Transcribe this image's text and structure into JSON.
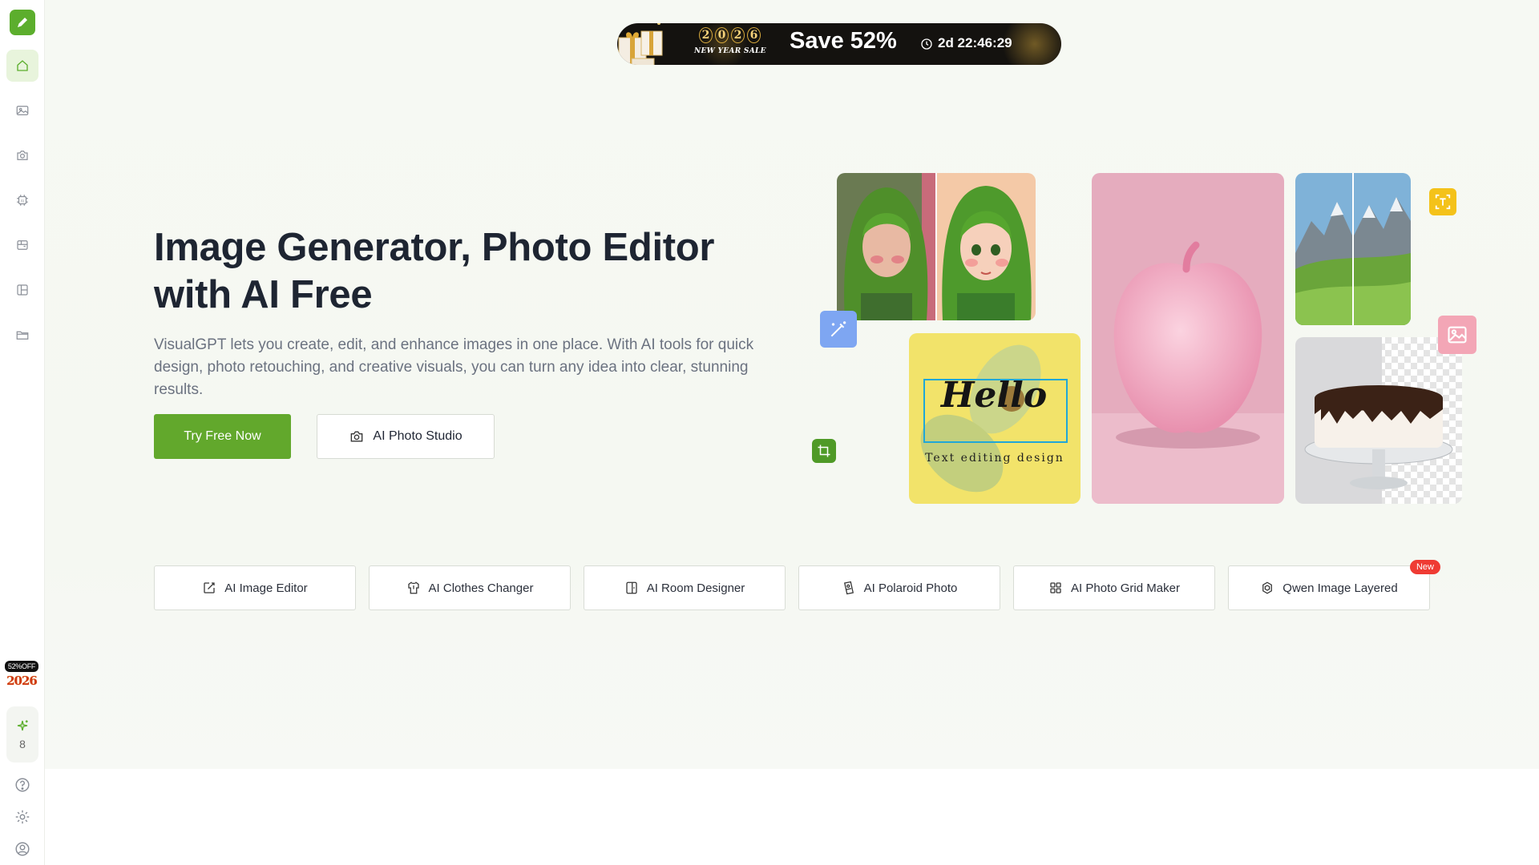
{
  "promo": {
    "year_digits": [
      "2",
      "0",
      "2",
      "6"
    ],
    "subtitle": "NEW YEAR SALE",
    "save_text": "Save 52%",
    "timer": "2d 22:46:29"
  },
  "hero": {
    "title": "Image Generator, Photo Editor with AI Free",
    "description": "VisualGPT lets you create, edit, and enhance images in one place. With AI tools for quick design, photo retouching, and creative visuals, you can turn any idea into clear, stunning results.",
    "primary_button": "Try Free Now",
    "secondary_button": "AI Photo Studio"
  },
  "collage": {
    "hello_text": "Hello",
    "hello_caption": "Text editing design"
  },
  "tools": [
    {
      "label": "AI Image Editor",
      "icon": "edit-image-icon"
    },
    {
      "label": "AI Clothes Changer",
      "icon": "shirt-icon"
    },
    {
      "label": "AI Room Designer",
      "icon": "room-icon"
    },
    {
      "label": "AI Polaroid Photo",
      "icon": "polaroid-icon"
    },
    {
      "label": "AI Photo Grid Maker",
      "icon": "grid-icon"
    },
    {
      "label": "Qwen Image Layered",
      "icon": "qwen-icon",
      "badge": "New"
    }
  ],
  "sidebar": {
    "items": [
      {
        "name": "home-icon",
        "active": true
      },
      {
        "name": "image-icon"
      },
      {
        "name": "camera-icon"
      },
      {
        "name": "ai-chip-icon"
      },
      {
        "name": "toolbox-icon"
      },
      {
        "name": "layout-icon"
      },
      {
        "name": "folder-icon"
      }
    ],
    "sale_badge": "52%OFF",
    "sale_year": "2026",
    "credits": "8"
  },
  "colors": {
    "brand_green": "#62a82c",
    "active_bg": "#e8f4dc",
    "badge_red": "#ef3b33"
  }
}
